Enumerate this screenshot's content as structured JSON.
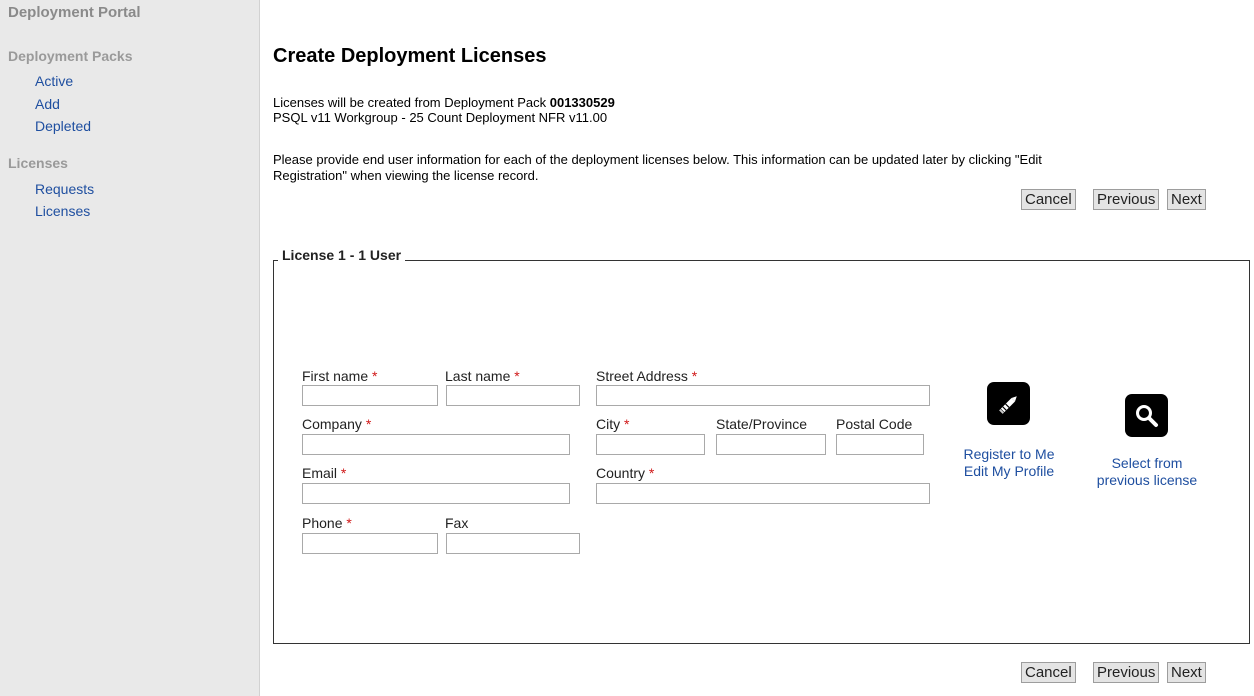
{
  "sidebar": {
    "title": "Deployment Portal",
    "sections": [
      {
        "title": "Deployment Packs",
        "items": [
          "Active",
          "Add",
          "Depleted"
        ]
      },
      {
        "title": "Licenses",
        "items": [
          "Requests",
          "Licenses"
        ]
      }
    ]
  },
  "main": {
    "page_title": "Create Deployment Licenses",
    "pack_prefix": "Licenses will be created from Deployment Pack ",
    "pack_number": "001330529",
    "pack_description": "PSQL v11 Workgroup - 25 Count Deployment NFR v11.00",
    "instructions_line1": "Please provide end user information for each of the deployment licenses below. This information can be updated later by clicking \"Edit",
    "instructions_line2": "Registration\" when viewing the license record.",
    "buttons": {
      "cancel": "Cancel",
      "previous": "Previous",
      "next": "Next"
    },
    "license": {
      "legend": "License 1 - 1 User",
      "required_marker": "*",
      "fields": {
        "first_name": "First name",
        "last_name": "Last name",
        "street_address": "Street Address",
        "company": "Company",
        "city": "City",
        "state": "State/Province",
        "postal_code": "Postal Code",
        "email": "Email",
        "country": "Country",
        "phone": "Phone",
        "fax": "Fax"
      },
      "values": {
        "first_name": "",
        "last_name": "",
        "street_address": "",
        "company": "",
        "city": "",
        "state": "",
        "postal_code": "",
        "email": "",
        "country": "",
        "phone": "",
        "fax": ""
      },
      "actions": {
        "register_line1": "Register to Me",
        "register_line2": "Edit My Profile",
        "select_line1": "Select from",
        "select_line2": "previous license",
        "register_icon": "pencil-icon",
        "select_icon": "magnifier-icon"
      }
    }
  },
  "colors": {
    "link": "#1f4fa0",
    "required": "#d01818",
    "sidebar_bg": "#e9e9e9",
    "muted_heading": "#9a9a9a"
  }
}
